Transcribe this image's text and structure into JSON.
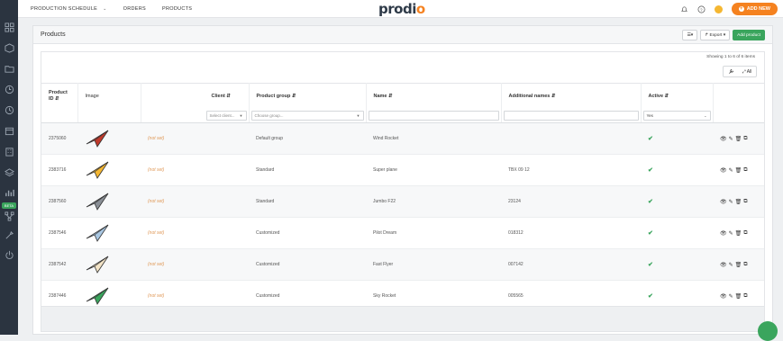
{
  "topnav": {
    "items": [
      "PRODUCTION SCHEDULE",
      "ORDERS",
      "PRODUCTS"
    ],
    "caret": "⌄"
  },
  "logo": {
    "text_a": "prod",
    "text_b": "i",
    "text_c": "o"
  },
  "header": {
    "add_new": "ADD NEW"
  },
  "panel": {
    "title": "Products"
  },
  "buttons": {
    "view": "☰▾",
    "export": "↱ Export ▾",
    "add_product": "Add product"
  },
  "showing": "Showing 1 to 6 of 6 items",
  "tools": {
    "wrench": "🔧",
    "expand": "⤢ All"
  },
  "table": {
    "headers": [
      {
        "line1": "Product",
        "line2": "ID ⇵"
      },
      {
        "line1": "Image",
        "line2": ""
      },
      {
        "line1": "Client ⇵",
        "line2": ""
      },
      {
        "line1": "Product group ⇵",
        "line2": ""
      },
      {
        "line1": "Name ⇵",
        "line2": ""
      },
      {
        "line1": "Additional names ⇵",
        "line2": ""
      },
      {
        "line1": "Active ⇵",
        "line2": ""
      },
      {
        "line1": "",
        "line2": ""
      }
    ],
    "filters": {
      "client_placeholder": "Select client...",
      "group_placeholder": "Choose group...",
      "active_value": "Yes"
    },
    "rows": [
      {
        "id": "2375060",
        "client": "(not set)",
        "group": "Default group",
        "name": "Wind Rocket",
        "additional": "",
        "active": "✔",
        "plane_color": "#c0392b"
      },
      {
        "id": "2383716",
        "client": "(not set)",
        "group": "Standard",
        "name": "Super plane",
        "additional": "TBX 09 12",
        "active": "✔",
        "plane_color": "#f5b731"
      },
      {
        "id": "2387560",
        "client": "(not set)",
        "group": "Standard",
        "name": "Jumbo F22",
        "additional": "23124",
        "active": "✔",
        "plane_color": "#8a8f96"
      },
      {
        "id": "2387546",
        "client": "(not set)",
        "group": "Customized",
        "name": "Pilot Dream",
        "additional": "018312",
        "active": "✔",
        "plane_color": "#a9c7e2"
      },
      {
        "id": "2387542",
        "client": "(not set)",
        "group": "Customized",
        "name": "Fast Flyer",
        "additional": "007142",
        "active": "✔",
        "plane_color": "#f3e4c7"
      },
      {
        "id": "2387446",
        "client": "(not set)",
        "group": "Customized",
        "name": "Sky Rocket",
        "additional": "005565",
        "active": "✔",
        "plane_color": "#3aa55d"
      }
    ]
  },
  "sidebar": {
    "beta": "BETA"
  }
}
